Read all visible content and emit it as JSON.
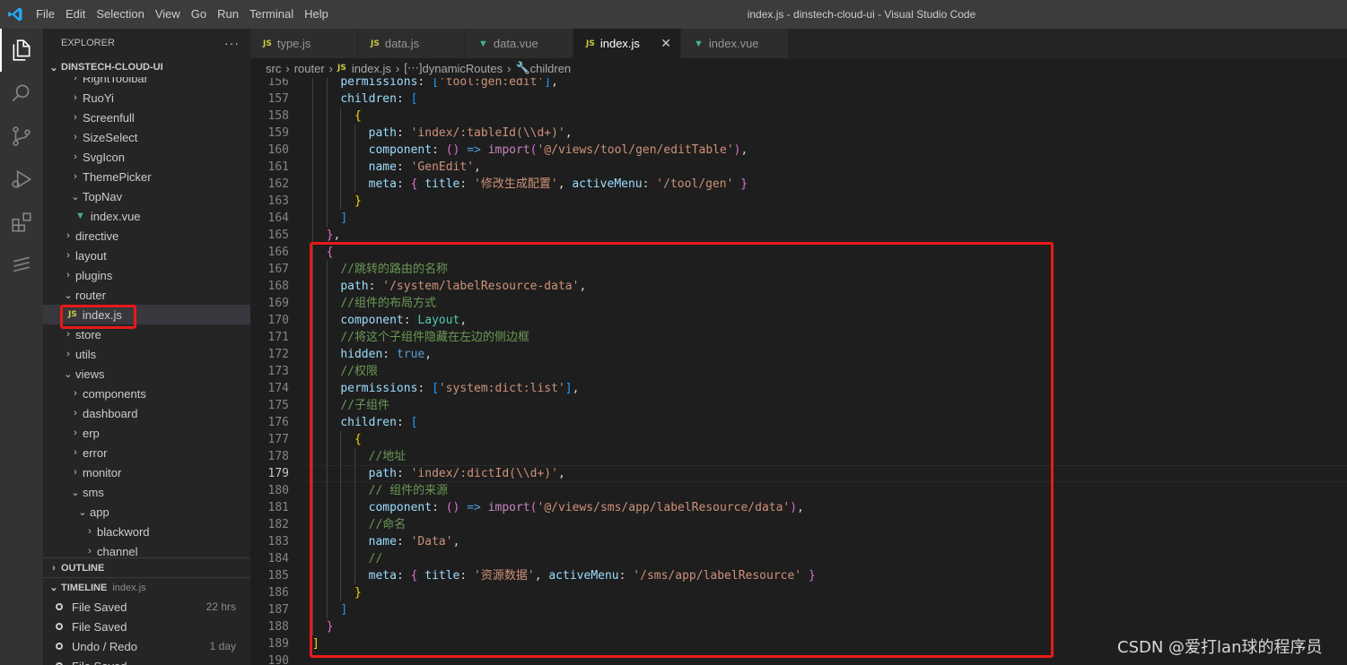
{
  "window": {
    "title": "index.js - dinstech-cloud-ui - Visual Studio Code",
    "menu": [
      "File",
      "Edit",
      "Selection",
      "View",
      "Go",
      "Run",
      "Terminal",
      "Help"
    ]
  },
  "activity_bar": [
    "files-icon",
    "search-icon",
    "source-control-icon",
    "run-debug-icon",
    "extensions-icon",
    "remote-icon"
  ],
  "sidebar": {
    "header": "EXPLORER",
    "more": "···",
    "project": "DINSTECH-CLOUD-UI",
    "tree": [
      {
        "label": "RightToolbar",
        "depth": 2,
        "kind": "folder"
      },
      {
        "label": "RuoYi",
        "depth": 2,
        "kind": "folder"
      },
      {
        "label": "Screenfull",
        "depth": 2,
        "kind": "folder"
      },
      {
        "label": "SizeSelect",
        "depth": 2,
        "kind": "folder"
      },
      {
        "label": "SvgIcon",
        "depth": 2,
        "kind": "folder"
      },
      {
        "label": "ThemePicker",
        "depth": 2,
        "kind": "folder"
      },
      {
        "label": "TopNav",
        "depth": 2,
        "kind": "folder-open"
      },
      {
        "label": "index.vue",
        "depth": 3,
        "kind": "vue"
      },
      {
        "label": "directive",
        "depth": 1,
        "kind": "folder"
      },
      {
        "label": "layout",
        "depth": 1,
        "kind": "folder"
      },
      {
        "label": "plugins",
        "depth": 1,
        "kind": "folder"
      },
      {
        "label": "router",
        "depth": 1,
        "kind": "folder-open"
      },
      {
        "label": "index.js",
        "depth": 2,
        "kind": "js",
        "selected": true
      },
      {
        "label": "store",
        "depth": 1,
        "kind": "folder"
      },
      {
        "label": "utils",
        "depth": 1,
        "kind": "folder"
      },
      {
        "label": "views",
        "depth": 1,
        "kind": "folder-open"
      },
      {
        "label": "components",
        "depth": 2,
        "kind": "folder"
      },
      {
        "label": "dashboard",
        "depth": 2,
        "kind": "folder"
      },
      {
        "label": "erp",
        "depth": 2,
        "kind": "folder"
      },
      {
        "label": "error",
        "depth": 2,
        "kind": "folder"
      },
      {
        "label": "monitor",
        "depth": 2,
        "kind": "folder"
      },
      {
        "label": "sms",
        "depth": 2,
        "kind": "folder-open"
      },
      {
        "label": "app",
        "depth": 3,
        "kind": "folder-open"
      },
      {
        "label": "blackword",
        "depth": 4,
        "kind": "folder"
      },
      {
        "label": "channel",
        "depth": 4,
        "kind": "folder"
      }
    ],
    "outline": "OUTLINE",
    "timeline": {
      "title": "TIMELINE",
      "file": "index.js",
      "entries": [
        {
          "label": "File Saved",
          "time": "22 hrs"
        },
        {
          "label": "File Saved",
          "time": ""
        },
        {
          "label": "Undo / Redo",
          "time": "1 day"
        },
        {
          "label": "File Saved",
          "time": ""
        }
      ]
    }
  },
  "tabs": [
    {
      "label": "type.js",
      "icon": "JS",
      "active": false
    },
    {
      "label": "data.js",
      "icon": "JS",
      "active": false
    },
    {
      "label": "data.vue",
      "icon": "vue",
      "active": false
    },
    {
      "label": "index.js",
      "icon": "JS",
      "active": true,
      "close": "✕"
    },
    {
      "label": "index.vue",
      "icon": "vue",
      "active": false
    }
  ],
  "breadcrumb": {
    "items": [
      "src",
      "router",
      "index.js",
      "dynamicRoutes",
      "children"
    ],
    "separator": "›"
  },
  "editor": {
    "current_line": 179,
    "lines": [
      {
        "n": 156,
        "g": 2,
        "t": [
          [
            "    ",
            ""
          ],
          [
            "permissions",
            ""
          ],
          [
            ": ",
            "p"
          ],
          [
            "[",
            "b3"
          ],
          [
            "'tool:gen:edit'",
            "str"
          ],
          [
            "]",
            "b3"
          ],
          [
            ",",
            "p"
          ]
        ]
      },
      {
        "n": 157,
        "g": 2,
        "t": [
          [
            "    ",
            ""
          ],
          [
            "children",
            ""
          ],
          [
            ": ",
            "p"
          ],
          [
            "[",
            "b3"
          ]
        ]
      },
      {
        "n": 158,
        "g": 3,
        "t": [
          [
            "      ",
            ""
          ],
          [
            "{",
            "b1"
          ]
        ]
      },
      {
        "n": 159,
        "g": 4,
        "t": [
          [
            "        ",
            ""
          ],
          [
            "path",
            ""
          ],
          [
            ": ",
            "p"
          ],
          [
            "'index/:tableId(\\\\d+)'",
            "str"
          ],
          [
            ",",
            "p"
          ]
        ]
      },
      {
        "n": 160,
        "g": 4,
        "t": [
          [
            "        ",
            ""
          ],
          [
            "component",
            ""
          ],
          [
            ": ",
            "p"
          ],
          [
            "()",
            "b2"
          ],
          [
            " => ",
            "kw"
          ],
          [
            "import",
            "kw2"
          ],
          [
            "(",
            "b2"
          ],
          [
            "'@/views/tool/gen/editTable'",
            "str"
          ],
          [
            ")",
            "b2"
          ],
          [
            ",",
            "p"
          ]
        ]
      },
      {
        "n": 161,
        "g": 4,
        "t": [
          [
            "        ",
            ""
          ],
          [
            "name",
            ""
          ],
          [
            ": ",
            "p"
          ],
          [
            "'GenEdit'",
            "str"
          ],
          [
            ",",
            "p"
          ]
        ]
      },
      {
        "n": 162,
        "g": 4,
        "t": [
          [
            "        ",
            ""
          ],
          [
            "meta",
            ""
          ],
          [
            ": ",
            "p"
          ],
          [
            "{",
            "b2"
          ],
          [
            " title",
            ""
          ],
          [
            ": ",
            "p"
          ],
          [
            "'修改生成配置'",
            "str"
          ],
          [
            ", ",
            "p"
          ],
          [
            "activeMenu",
            ""
          ],
          [
            ": ",
            "p"
          ],
          [
            "'/tool/gen'",
            "str"
          ],
          [
            " }",
            "b2"
          ]
        ]
      },
      {
        "n": 163,
        "g": 3,
        "t": [
          [
            "      ",
            ""
          ],
          [
            "}",
            "b1"
          ]
        ]
      },
      {
        "n": 164,
        "g": 2,
        "t": [
          [
            "    ",
            ""
          ],
          [
            "]",
            "b3"
          ]
        ]
      },
      {
        "n": 165,
        "g": 1,
        "t": [
          [
            "  ",
            ""
          ],
          [
            "}",
            "b2"
          ],
          [
            ",",
            "p"
          ]
        ]
      },
      {
        "n": 166,
        "g": 1,
        "t": [
          [
            "  ",
            ""
          ],
          [
            "{",
            "b2"
          ]
        ]
      },
      {
        "n": 167,
        "g": 2,
        "t": [
          [
            "    ",
            ""
          ],
          [
            "//跳转的路由的名称",
            "cm"
          ]
        ]
      },
      {
        "n": 168,
        "g": 2,
        "t": [
          [
            "    ",
            ""
          ],
          [
            "path",
            ""
          ],
          [
            ": ",
            "p"
          ],
          [
            "'/system/labelResource-data'",
            "str"
          ],
          [
            ",",
            "p"
          ]
        ]
      },
      {
        "n": 169,
        "g": 2,
        "t": [
          [
            "    ",
            ""
          ],
          [
            "//组件的布局方式",
            "cm"
          ]
        ]
      },
      {
        "n": 170,
        "g": 2,
        "t": [
          [
            "    ",
            ""
          ],
          [
            "component",
            ""
          ],
          [
            ": ",
            "p"
          ],
          [
            "Layout",
            "cls"
          ],
          [
            ",",
            "p"
          ]
        ]
      },
      {
        "n": 171,
        "g": 2,
        "t": [
          [
            "    ",
            ""
          ],
          [
            "//将这个子组件隐藏在左边的侧边框",
            "cm"
          ]
        ]
      },
      {
        "n": 172,
        "g": 2,
        "t": [
          [
            "    ",
            ""
          ],
          [
            "hidden",
            ""
          ],
          [
            ": ",
            "p"
          ],
          [
            "true",
            "kw"
          ],
          [
            ",",
            "p"
          ]
        ]
      },
      {
        "n": 173,
        "g": 2,
        "t": [
          [
            "    ",
            ""
          ],
          [
            "//权限",
            "cm"
          ]
        ]
      },
      {
        "n": 174,
        "g": 2,
        "t": [
          [
            "    ",
            ""
          ],
          [
            "permissions",
            ""
          ],
          [
            ": ",
            "p"
          ],
          [
            "[",
            "b3"
          ],
          [
            "'system:dict:list'",
            "str"
          ],
          [
            "]",
            "b3"
          ],
          [
            ",",
            "p"
          ]
        ]
      },
      {
        "n": 175,
        "g": 2,
        "t": [
          [
            "    ",
            ""
          ],
          [
            "//子组件",
            "cm"
          ]
        ]
      },
      {
        "n": 176,
        "g": 2,
        "t": [
          [
            "    ",
            ""
          ],
          [
            "children",
            ""
          ],
          [
            ": ",
            "p"
          ],
          [
            "[",
            "b3"
          ]
        ]
      },
      {
        "n": 177,
        "g": 3,
        "t": [
          [
            "      ",
            ""
          ],
          [
            "{",
            "b1"
          ]
        ]
      },
      {
        "n": 178,
        "g": 4,
        "t": [
          [
            "        ",
            ""
          ],
          [
            "//地址",
            "cm"
          ]
        ]
      },
      {
        "n": 179,
        "g": 4,
        "t": [
          [
            "        ",
            ""
          ],
          [
            "path",
            ""
          ],
          [
            ": ",
            "p"
          ],
          [
            "'index/:dictId(\\\\d+)'",
            "str"
          ],
          [
            ",",
            "p"
          ]
        ]
      },
      {
        "n": 180,
        "g": 4,
        "t": [
          [
            "        ",
            ""
          ],
          [
            "// 组件的来源",
            "cm"
          ]
        ]
      },
      {
        "n": 181,
        "g": 4,
        "t": [
          [
            "        ",
            ""
          ],
          [
            "component",
            ""
          ],
          [
            ": ",
            "p"
          ],
          [
            "()",
            "b2"
          ],
          [
            " => ",
            "kw"
          ],
          [
            "import",
            "kw2"
          ],
          [
            "(",
            "b2"
          ],
          [
            "'@/views/sms/app/labelResource/data'",
            "str"
          ],
          [
            ")",
            "b2"
          ],
          [
            ",",
            "p"
          ]
        ]
      },
      {
        "n": 182,
        "g": 4,
        "t": [
          [
            "        ",
            ""
          ],
          [
            "//命名",
            "cm"
          ]
        ]
      },
      {
        "n": 183,
        "g": 4,
        "t": [
          [
            "        ",
            ""
          ],
          [
            "name",
            ""
          ],
          [
            ": ",
            "p"
          ],
          [
            "'Data'",
            "str"
          ],
          [
            ",",
            "p"
          ]
        ]
      },
      {
        "n": 184,
        "g": 4,
        "t": [
          [
            "        ",
            ""
          ],
          [
            "//",
            "cm"
          ]
        ]
      },
      {
        "n": 185,
        "g": 4,
        "t": [
          [
            "        ",
            ""
          ],
          [
            "meta",
            ""
          ],
          [
            ": ",
            "p"
          ],
          [
            "{",
            "b2"
          ],
          [
            " title",
            ""
          ],
          [
            ": ",
            "p"
          ],
          [
            "'资源数据'",
            "str"
          ],
          [
            ", ",
            "p"
          ],
          [
            "activeMenu",
            ""
          ],
          [
            ": ",
            "p"
          ],
          [
            "'/sms/app/labelResource'",
            "str"
          ],
          [
            " }",
            "b2"
          ]
        ]
      },
      {
        "n": 186,
        "g": 3,
        "t": [
          [
            "      ",
            ""
          ],
          [
            "}",
            "b1"
          ]
        ]
      },
      {
        "n": 187,
        "g": 2,
        "t": [
          [
            "    ",
            ""
          ],
          [
            "]",
            "b3"
          ]
        ]
      },
      {
        "n": 188,
        "g": 1,
        "t": [
          [
            "  ",
            ""
          ],
          [
            "}",
            "b2"
          ]
        ]
      },
      {
        "n": 189,
        "g": 0,
        "t": [
          [
            "]",
            "b1"
          ]
        ]
      },
      {
        "n": 190,
        "g": 0,
        "t": []
      }
    ]
  },
  "watermark": "CSDN @爱打lan球的程序员",
  "colors": {
    "highlight": "#e81a1a",
    "accent": "#007acc"
  }
}
